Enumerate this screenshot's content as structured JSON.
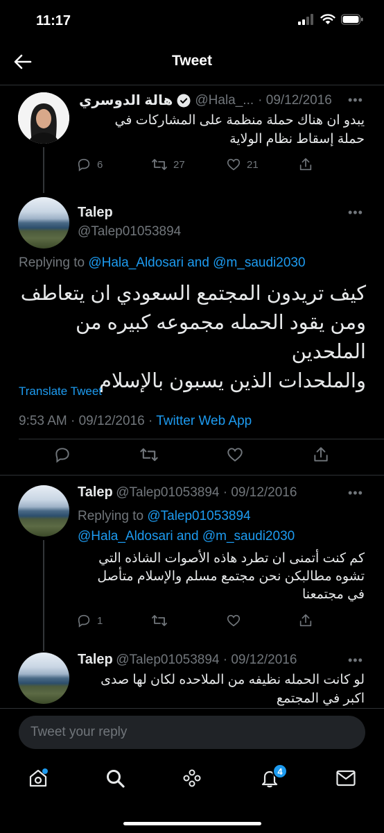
{
  "status": {
    "time": "11:17"
  },
  "header": {
    "title": "Tweet"
  },
  "tweet1": {
    "name": "هالة الدوسري",
    "handle": "@Hala_...",
    "date": "· 09/12/2016",
    "text_line1": "يبدو ان هناك حملة منظمة على المشاركات في",
    "text_line2": "حملة إسقاط نظام الولاية",
    "replies": "6",
    "retweets": "27",
    "likes": "21"
  },
  "main": {
    "name": "Talep",
    "handle": "@Talep01053894",
    "replying_prefix": "Replying to",
    "replying_to": "@Hala_Aldosari and @m_saudi2030",
    "text_line1": "كيف تريدون المجتمع السعودي ان يتعاطف",
    "text_line2": "ومن يقود الحمله مجموعه كبيره من الملحدين",
    "text_line3": "والملحدات الذين يسبون بالإسلام",
    "translate": "Translate Tweet",
    "time_date": "9:53 AM · 09/12/2016 ·",
    "source": "Twitter Web App"
  },
  "reply1": {
    "name": "Talep",
    "handle": "@Talep01053894 · 09/12/2016",
    "replying_prefix": "Replying to",
    "replying_to_1": "@Talep01053894",
    "replying_to_2": "@Hala_Aldosari and @m_saudi2030",
    "text_line1": "كم كنت أتمنى ان تطرد هاذه الأصوات الشاذه التي",
    "text_line2": "تشوه مطالبكن نحن مجتمع مسلم والإسلام متأصل",
    "text_line3": "في مجتمعنا",
    "replies": "1"
  },
  "reply2": {
    "name": "Talep",
    "handle": "@Talep01053894 · 09/12/2016",
    "text_line1": "لو كانت الحمله نظيفه من الملاحده لكان لها صدى",
    "text_line2": "اكبر في المجتمع"
  },
  "composer": {
    "placeholder": "Tweet your reply"
  },
  "tabbar": {
    "notifications_badge": "4"
  },
  "colors": {
    "accent": "#1d9bf0",
    "background": "#000000",
    "muted": "#71767b"
  }
}
